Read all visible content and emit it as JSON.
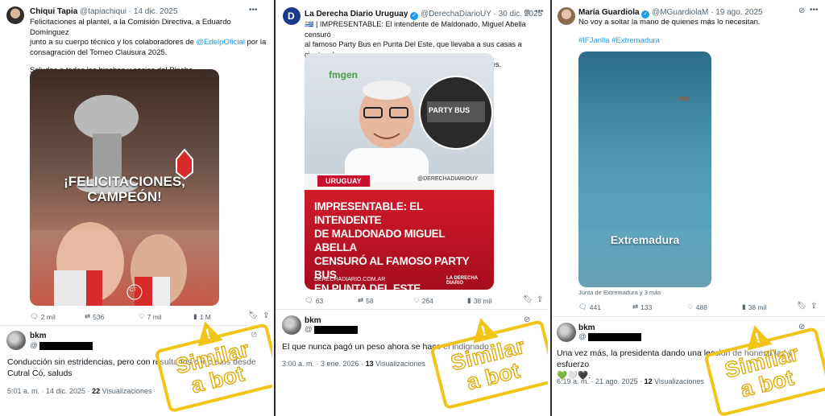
{
  "panels": [
    {
      "author_name": "Chiqui Tapia",
      "author_handle": "@tapiachiqui",
      "date": "· 14 dic. 2025",
      "text_lines": [
        "Felicitaciones al plantel, a la Comisión Directiva, a Eduardo Domínguez",
        "junto a su cuerpo técnico y los colaboradores de ",
        "consagración del Torneo Clausura 2025."
      ],
      "mention": "@EdelpOficial",
      "mention_after": " por la",
      "text_extra": "Saludos a todos los hinchas y socios del Pincha.",
      "media_caption": "¡FELICITACIONES, CAMPEÓN!",
      "media_watermark": "CT",
      "actions": {
        "reply": "2 mil",
        "repost": "536",
        "like": "7 mil",
        "views": "1 M"
      },
      "reply": {
        "name": "bkm",
        "handle": "@",
        "text_lines": [
          "Conducción sin estridencias, pero con resultados concretos desde",
          "Cutral Có, saluds"
        ],
        "time": "5:01 a. m. · 14 dic. 2025 · ",
        "views": "22",
        "views_label": " Visualizaciones"
      },
      "stamp": {
        "line1": "Similar",
        "line2": "a bot"
      }
    },
    {
      "author_name": "La Derecha Diario Uruguay",
      "author_handle": "@DerechaDiarioUY",
      "date": "· 30 dic. 2025",
      "text_lines": [
        "🇺🇾 | IMPRESENTABLE: El intendente de Maldonado, Miguel Abella censuró",
        "al famoso Party Bus en Punta Del Este, que llevaba a sus casas a cientos de",
        "jóvenes en las fiestas y contaba con todas las regulaciones."
      ],
      "media_tag": "URUGUAY",
      "media_handle": "@DERECHADIARIOUY",
      "media_headline": [
        "IMPRESENTABLE: EL INTENDENTE",
        "DE MALDONADO MIGUEL ABELLA",
        "CENSURÓ AL FAMOSO PARTY BUS",
        "EN PUNTA DEL ESTE"
      ],
      "media_site": "DERECHADIARIO.COM.AR",
      "media_brand": "LA DERECHA DIARIO",
      "media_bg_text": "fmgen",
      "media_sign": "PARTY BUS",
      "actions": {
        "reply": "63",
        "repost": "58",
        "like": "264",
        "views": "38 mil"
      },
      "reply": {
        "name": "bkm",
        "handle": "@",
        "text_lines": [
          "El que nunca pagó un peso ahora se hace el indignado."
        ],
        "time": "3:00 a. m. · 3 ene. 2026 · ",
        "views": "13",
        "views_label": " Visualizaciones"
      },
      "stamp": {
        "line1": "Similar",
        "line2": "a bot"
      }
    },
    {
      "author_name": "María Guardiola",
      "author_handle": "@MGuardiolaM",
      "date": "· 19 ago. 2025",
      "text_lines": [
        "No voy a soltar la mano de quienes más lo necesitan."
      ],
      "hashtags": "#IFJarilla #Extremadura",
      "media_caption": "Extremadura",
      "media_credit": "Junta de Extremadura y 3 más",
      "actions": {
        "reply": "441",
        "repost": "133",
        "like": "488",
        "views": "38 mil"
      },
      "reply": {
        "name": "bkm",
        "handle": "@",
        "text_lines": [
          "Una vez más, la presidenta dando una lección de honestidad y esfuerzo",
          "💚🤍🖤."
        ],
        "time": "6:19 a. m. · 21 ago. 2025 · ",
        "views": "12",
        "views_label": " Visualizaciones"
      },
      "stamp": {
        "line1": "Similar",
        "line2": "a bot"
      }
    }
  ],
  "colors": {
    "accent": "#1d9bf0",
    "stamp": "#f2c418",
    "uy_red": "#c8102e"
  }
}
